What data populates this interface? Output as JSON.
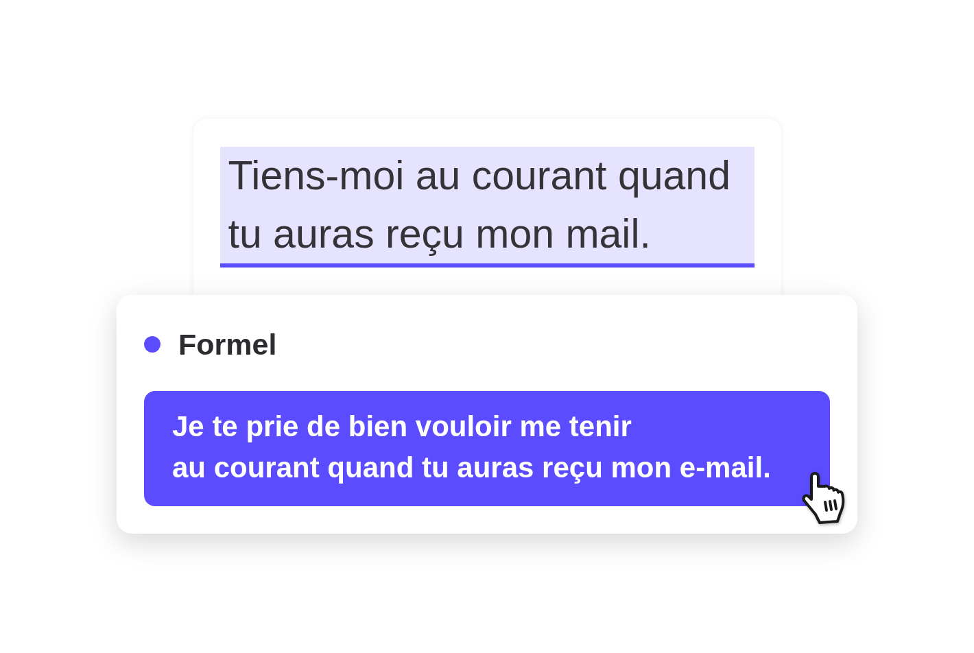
{
  "original": {
    "lines": [
      "Tiens-moi au courant quand",
      "tu auras reçu mon mail."
    ],
    "highlighted": true
  },
  "suggestion_card": {
    "tone": {
      "label": "Formel",
      "color": "#5b4cff"
    },
    "suggestion": {
      "lines": [
        "Je te prie de bien vouloir me tenir",
        "au courant quand tu auras reçu mon e-mail."
      ]
    }
  }
}
